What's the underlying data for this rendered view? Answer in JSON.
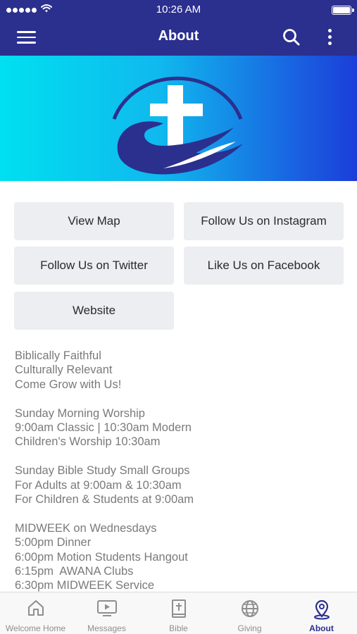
{
  "status_bar": {
    "time": "10:26 AM"
  },
  "header": {
    "title": "About"
  },
  "buttons": [
    {
      "label": "View Map"
    },
    {
      "label": "Follow Us on Instagram"
    },
    {
      "label": "Follow Us on Twitter"
    },
    {
      "label": "Like Us on Facebook"
    },
    {
      "label": "Website"
    }
  ],
  "info": [
    [
      "Biblically Faithful",
      "Culturally Relevant",
      "Come Grow with Us!"
    ],
    [
      "Sunday Morning Worship",
      "9:00am Classic | 10:30am Modern",
      "Children's Worship 10:30am"
    ],
    [
      "Sunday Bible Study Small Groups",
      "For Adults at 9:00am & 10:30am",
      "For Children & Students at 9:00am"
    ],
    [
      "MIDWEEK on Wednesdays",
      "5:00pm Dinner",
      "6:00pm Motion Students Hangout",
      "6:15pm  AWANA Clubs",
      "6:30pm MIDWEEK Service"
    ]
  ],
  "tabs": [
    {
      "label": "Welcome Home",
      "icon": "home-icon",
      "active": false
    },
    {
      "label": "Messages",
      "icon": "tv-play-icon",
      "active": false
    },
    {
      "label": "Bible",
      "icon": "bible-icon",
      "active": false
    },
    {
      "label": "Giving",
      "icon": "globe-icon",
      "active": false
    },
    {
      "label": "About",
      "icon": "location-pin-icon",
      "active": true
    }
  ],
  "colors": {
    "header": "#2b2f8e",
    "active_tab": "#2b2f8e",
    "inactive_tab": "#8e8e8e",
    "button_bg": "#eceef1",
    "info_text": "#7a7a7a"
  }
}
